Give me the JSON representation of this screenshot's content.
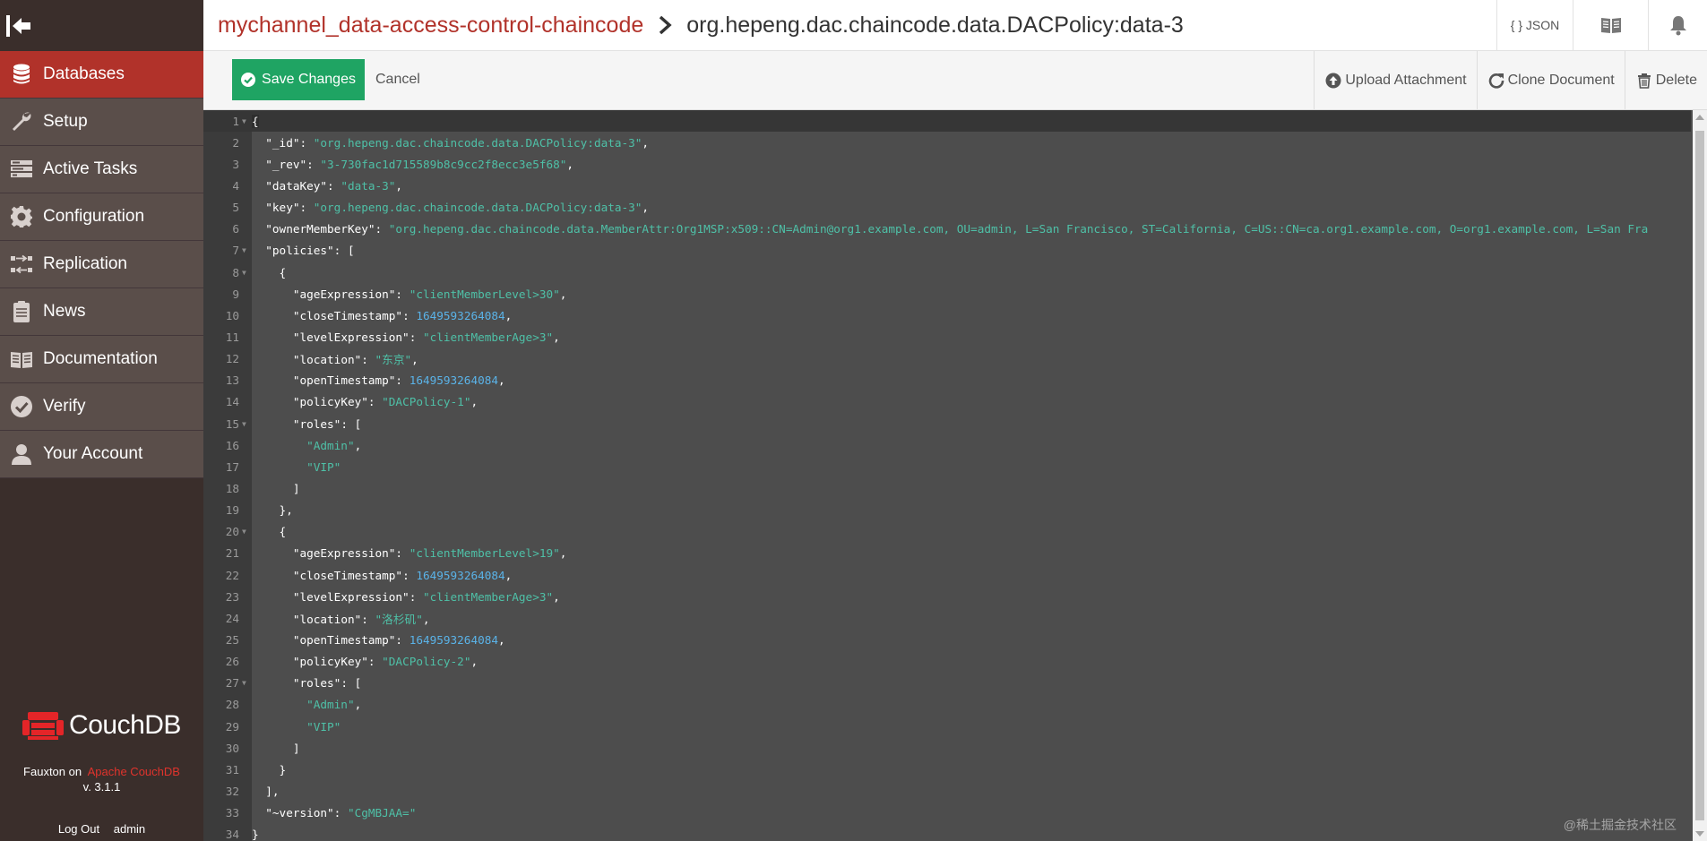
{
  "sidebar": {
    "items": [
      {
        "label": "Databases",
        "icon": "database-icon",
        "active": true
      },
      {
        "label": "Setup",
        "icon": "wrench-icon"
      },
      {
        "label": "Active Tasks",
        "icon": "tasks-icon"
      },
      {
        "label": "Configuration",
        "icon": "gear-icon"
      },
      {
        "label": "Replication",
        "icon": "replication-icon"
      },
      {
        "label": "News",
        "icon": "clipboard-icon"
      },
      {
        "label": "Documentation",
        "icon": "book-icon"
      },
      {
        "label": "Verify",
        "icon": "check-icon"
      },
      {
        "label": "Your Account",
        "icon": "user-icon"
      }
    ],
    "brand": "CouchDB",
    "fauxton": "Fauxton on",
    "apache": "Apache CouchDB",
    "version": "v. 3.1.1",
    "logout": "Log Out",
    "user": "admin"
  },
  "header": {
    "database": "mychannel_data-access-control-chaincode",
    "document": "org.hepeng.dac.chaincode.data.DACPolicy:data-3",
    "json_label": "{ } JSON"
  },
  "toolbar": {
    "save": "Save Changes",
    "cancel": "Cancel",
    "upload": "Upload Attachment",
    "clone": "Clone Document",
    "delete": "Delete"
  },
  "editor": {
    "lines": [
      [
        [
          "p",
          "{"
        ]
      ],
      [
        [
          "p",
          "  "
        ],
        [
          "k",
          "\"_id\""
        ],
        [
          "p",
          ": "
        ],
        [
          "s",
          "\"org.hepeng.dac.chaincode.data.DACPolicy:data-3\""
        ],
        [
          "p",
          ","
        ]
      ],
      [
        [
          "p",
          "  "
        ],
        [
          "k",
          "\"_rev\""
        ],
        [
          "p",
          ": "
        ],
        [
          "s",
          "\"3-730fac1d715589b8c9cc2f8ecc3e5f68\""
        ],
        [
          "p",
          ","
        ]
      ],
      [
        [
          "p",
          "  "
        ],
        [
          "k",
          "\"dataKey\""
        ],
        [
          "p",
          ": "
        ],
        [
          "s",
          "\"data-3\""
        ],
        [
          "p",
          ","
        ]
      ],
      [
        [
          "p",
          "  "
        ],
        [
          "k",
          "\"key\""
        ],
        [
          "p",
          ": "
        ],
        [
          "s",
          "\"org.hepeng.dac.chaincode.data.DACPolicy:data-3\""
        ],
        [
          "p",
          ","
        ]
      ],
      [
        [
          "p",
          "  "
        ],
        [
          "k",
          "\"ownerMemberKey\""
        ],
        [
          "p",
          ": "
        ],
        [
          "s",
          "\"org.hepeng.dac.chaincode.data.MemberAttr:Org1MSP:x509::CN=Admin@org1.example.com, OU=admin, L=San Francisco, ST=California, C=US::CN=ca.org1.example.com, O=org1.example.com, L=San Fra"
        ]
      ],
      [
        [
          "p",
          "  "
        ],
        [
          "k",
          "\"policies\""
        ],
        [
          "p",
          ": ["
        ]
      ],
      [
        [
          "p",
          "    {"
        ]
      ],
      [
        [
          "p",
          "      "
        ],
        [
          "k",
          "\"ageExpression\""
        ],
        [
          "p",
          ": "
        ],
        [
          "s",
          "\"clientMemberLevel>30\""
        ],
        [
          "p",
          ","
        ]
      ],
      [
        [
          "p",
          "      "
        ],
        [
          "k",
          "\"closeTimestamp\""
        ],
        [
          "p",
          ": "
        ],
        [
          "n",
          "1649593264084"
        ],
        [
          "p",
          ","
        ]
      ],
      [
        [
          "p",
          "      "
        ],
        [
          "k",
          "\"levelExpression\""
        ],
        [
          "p",
          ": "
        ],
        [
          "s",
          "\"clientMemberAge>3\""
        ],
        [
          "p",
          ","
        ]
      ],
      [
        [
          "p",
          "      "
        ],
        [
          "k",
          "\"location\""
        ],
        [
          "p",
          ": "
        ],
        [
          "s",
          "\"东京\""
        ],
        [
          "p",
          ","
        ]
      ],
      [
        [
          "p",
          "      "
        ],
        [
          "k",
          "\"openTimestamp\""
        ],
        [
          "p",
          ": "
        ],
        [
          "n",
          "1649593264084"
        ],
        [
          "p",
          ","
        ]
      ],
      [
        [
          "p",
          "      "
        ],
        [
          "k",
          "\"policyKey\""
        ],
        [
          "p",
          ": "
        ],
        [
          "s",
          "\"DACPolicy-1\""
        ],
        [
          "p",
          ","
        ]
      ],
      [
        [
          "p",
          "      "
        ],
        [
          "k",
          "\"roles\""
        ],
        [
          "p",
          ": ["
        ]
      ],
      [
        [
          "p",
          "        "
        ],
        [
          "s",
          "\"Admin\""
        ],
        [
          "p",
          ","
        ]
      ],
      [
        [
          "p",
          "        "
        ],
        [
          "s",
          "\"VIP\""
        ]
      ],
      [
        [
          "p",
          "      ]"
        ]
      ],
      [
        [
          "p",
          "    },"
        ]
      ],
      [
        [
          "p",
          "    {"
        ]
      ],
      [
        [
          "p",
          "      "
        ],
        [
          "k",
          "\"ageExpression\""
        ],
        [
          "p",
          ": "
        ],
        [
          "s",
          "\"clientMemberLevel>19\""
        ],
        [
          "p",
          ","
        ]
      ],
      [
        [
          "p",
          "      "
        ],
        [
          "k",
          "\"closeTimestamp\""
        ],
        [
          "p",
          ": "
        ],
        [
          "n",
          "1649593264084"
        ],
        [
          "p",
          ","
        ]
      ],
      [
        [
          "p",
          "      "
        ],
        [
          "k",
          "\"levelExpression\""
        ],
        [
          "p",
          ": "
        ],
        [
          "s",
          "\"clientMemberAge>3\""
        ],
        [
          "p",
          ","
        ]
      ],
      [
        [
          "p",
          "      "
        ],
        [
          "k",
          "\"location\""
        ],
        [
          "p",
          ": "
        ],
        [
          "s",
          "\"洛杉矶\""
        ],
        [
          "p",
          ","
        ]
      ],
      [
        [
          "p",
          "      "
        ],
        [
          "k",
          "\"openTimestamp\""
        ],
        [
          "p",
          ": "
        ],
        [
          "n",
          "1649593264084"
        ],
        [
          "p",
          ","
        ]
      ],
      [
        [
          "p",
          "      "
        ],
        [
          "k",
          "\"policyKey\""
        ],
        [
          "p",
          ": "
        ],
        [
          "s",
          "\"DACPolicy-2\""
        ],
        [
          "p",
          ","
        ]
      ],
      [
        [
          "p",
          "      "
        ],
        [
          "k",
          "\"roles\""
        ],
        [
          "p",
          ": ["
        ]
      ],
      [
        [
          "p",
          "        "
        ],
        [
          "s",
          "\"Admin\""
        ],
        [
          "p",
          ","
        ]
      ],
      [
        [
          "p",
          "        "
        ],
        [
          "s",
          "\"VIP\""
        ]
      ],
      [
        [
          "p",
          "      ]"
        ]
      ],
      [
        [
          "p",
          "    }"
        ]
      ],
      [
        [
          "p",
          "  ],"
        ]
      ],
      [
        [
          "p",
          "  "
        ],
        [
          "k",
          "\"~version\""
        ],
        [
          "p",
          ": "
        ],
        [
          "s",
          "\"CgMBJAA=\""
        ]
      ],
      [
        [
          "p",
          "}"
        ]
      ]
    ],
    "folds": [
      1,
      7,
      8,
      15,
      20,
      27
    ]
  },
  "watermark": "@稀土掘金技术社区"
}
